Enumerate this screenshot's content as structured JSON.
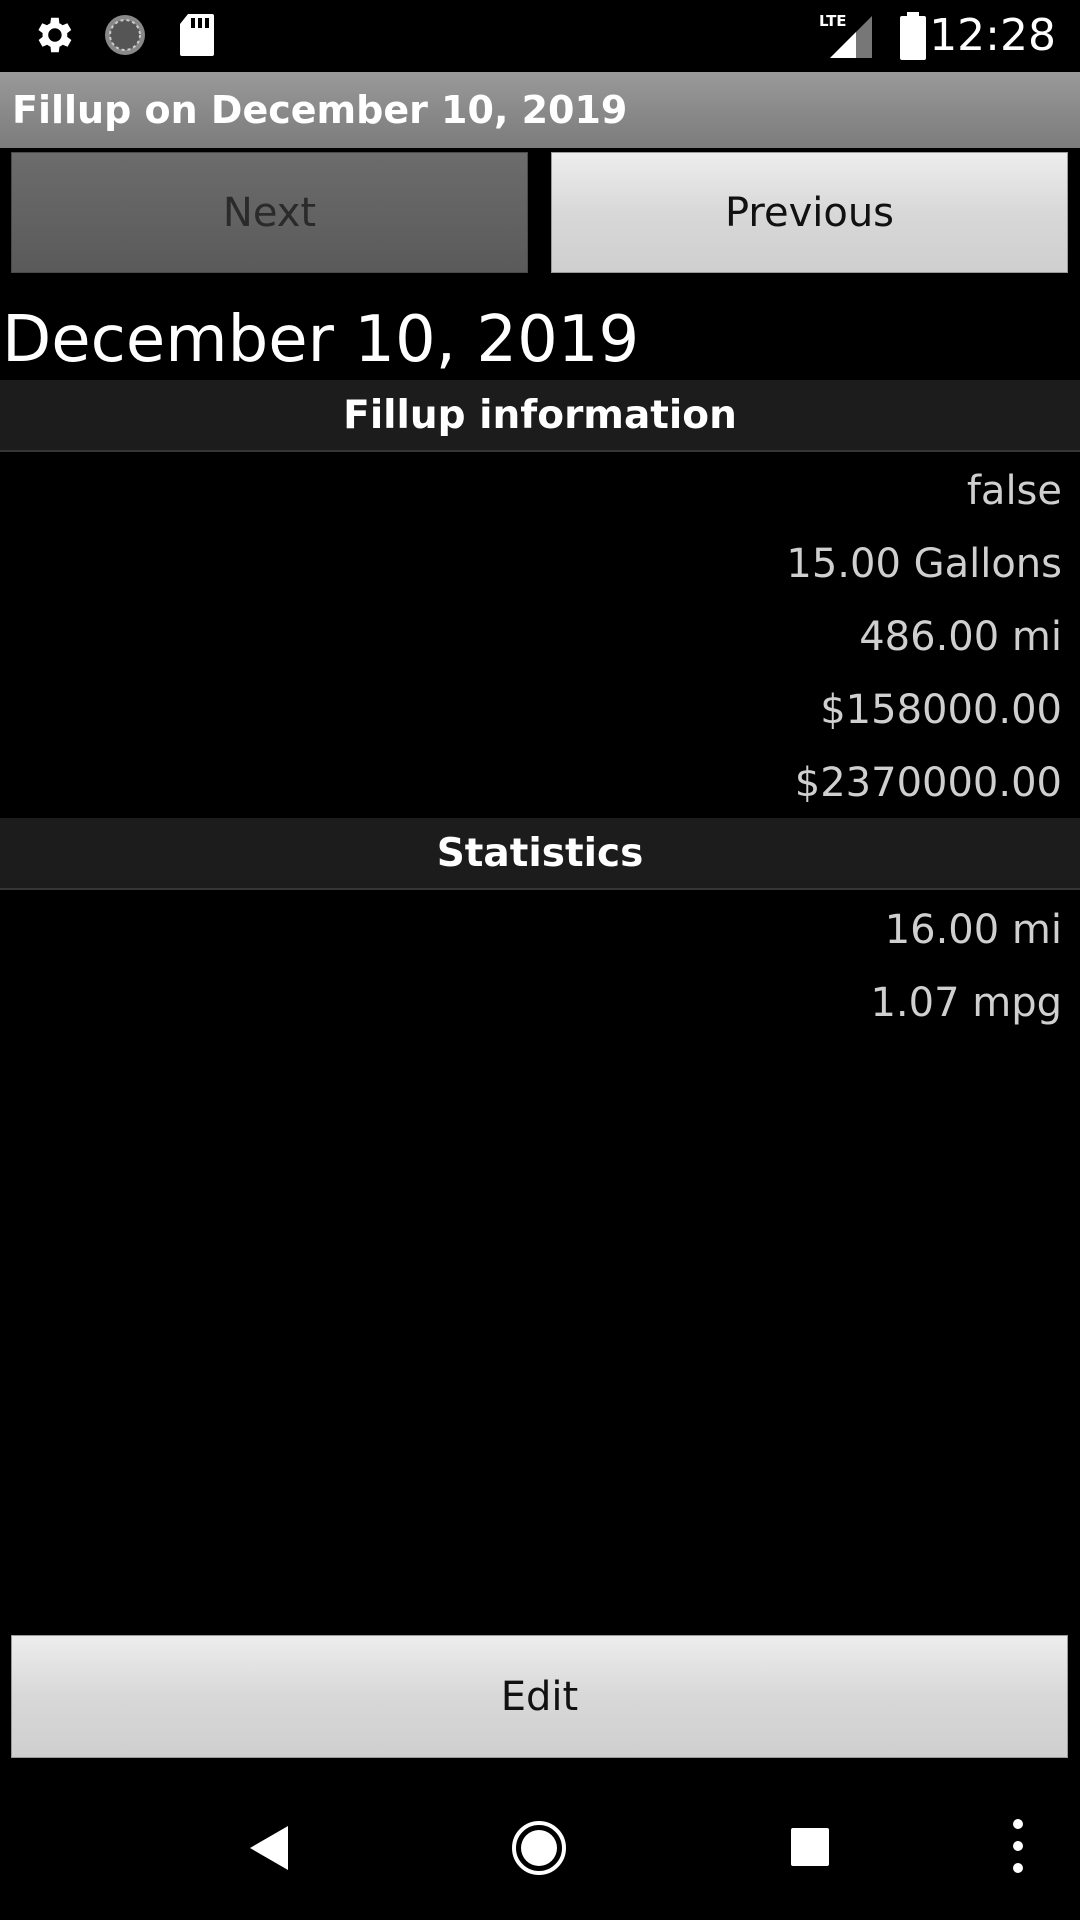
{
  "status_bar": {
    "time": "12:28",
    "network": "LTE",
    "icons": [
      "gear-icon",
      "sync-icon",
      "sd-card-icon",
      "signal-icon",
      "battery-icon"
    ]
  },
  "title_bar": {
    "title": "Fillup on December 10, 2019"
  },
  "navigation": {
    "next_label": "Next",
    "previous_label": "Previous"
  },
  "date_heading": "December 10, 2019",
  "fillup_section": {
    "header": "Fillup information",
    "values": [
      "false",
      "15.00 Gallons",
      "486.00 mi",
      "$158000.00",
      "$2370000.00"
    ]
  },
  "statistics_section": {
    "header": "Statistics",
    "values": [
      "16.00 mi",
      "1.07 mpg"
    ]
  },
  "edit_label": "Edit",
  "nav_bar": {
    "icons": [
      "back-icon",
      "home-icon",
      "recents-icon",
      "more-icon"
    ]
  },
  "colors": {
    "background": "#000000",
    "title_bar": "#8a8a8a",
    "section_header": "#1c1c1c",
    "value_text": "#cfcfcf"
  }
}
